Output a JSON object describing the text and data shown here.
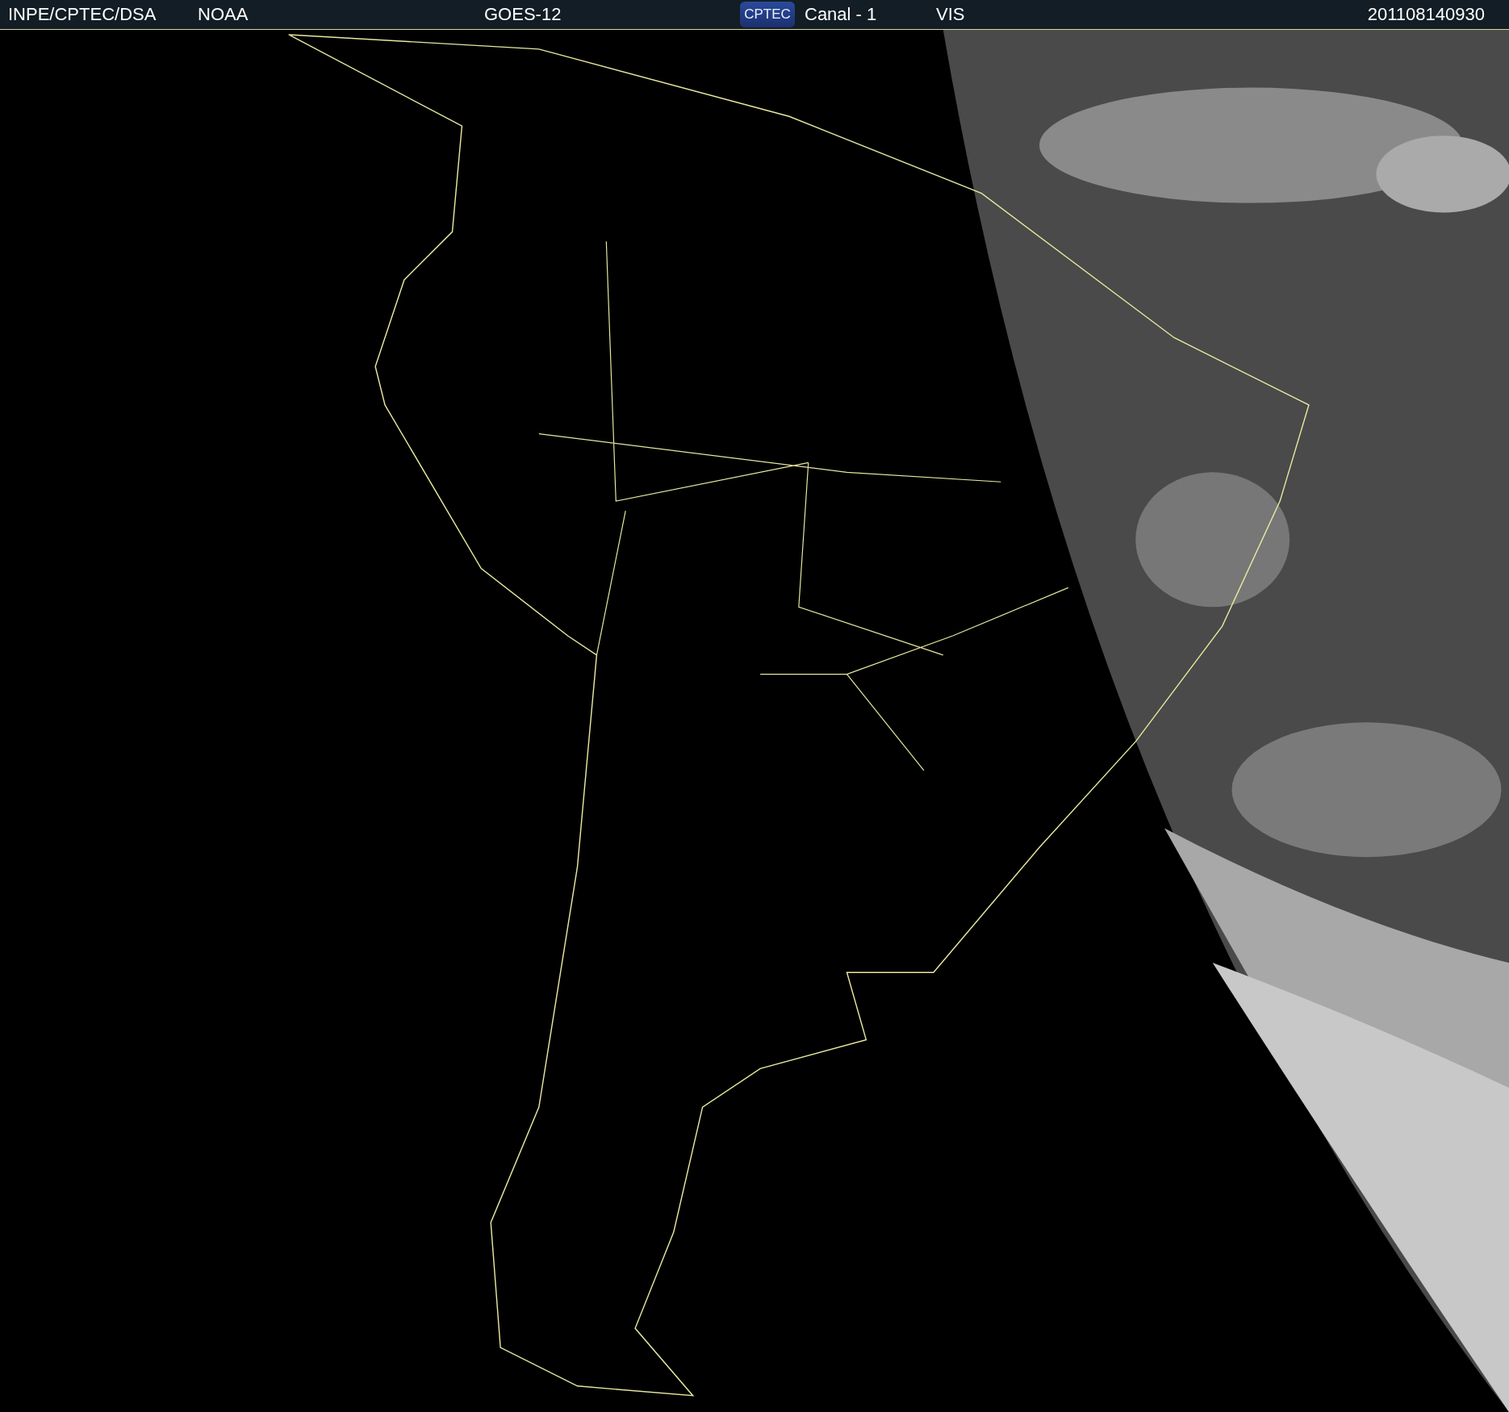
{
  "header": {
    "labels": [
      "INPE/CPTEC/DSA",
      "NOAA",
      "GOES-12",
      "Canal - 1",
      "VIS",
      "201108140930"
    ],
    "logo": {
      "text": "CPTEC"
    }
  }
}
